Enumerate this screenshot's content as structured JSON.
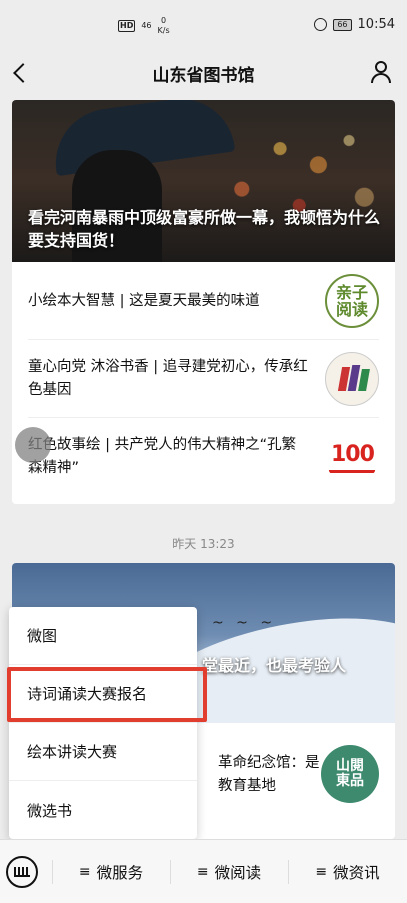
{
  "status": {
    "hd": "HD",
    "signal": "46",
    "speed_value": "0",
    "speed_unit": "K/s",
    "battery": "66",
    "time": "10:54"
  },
  "nav": {
    "title": "山东省图书馆"
  },
  "card1": {
    "headline": "看完河南暴雨中顶级富豪所做一幕，我顿悟为什么要支持国货！",
    "items": [
      {
        "text": "小绘本大智慧 | 这是夏天最美的味道",
        "thumb_text": "亲子阅读"
      },
      {
        "text": "童心向党 沐浴书香 | 追寻建党初心，传承红色基因",
        "thumb_text": ""
      },
      {
        "text": "红色故事绘 | 共产党人的伟大精神之“孔繁森精神”",
        "thumb_text": "100"
      }
    ]
  },
  "timestamp": "昨天 13:23",
  "card2": {
    "headline": "堂最近，也最考验人",
    "item_text": "革命纪念馆：是教育基地",
    "thumb_text": "山閱東品"
  },
  "menu": {
    "items": [
      "微图",
      "诗词诵读大赛报名",
      "绘本讲读大赛",
      "微选书"
    ],
    "highlighted_index": 1
  },
  "bottom": {
    "tabs": [
      "微服务",
      "微阅读",
      "微资讯"
    ],
    "menu_glyph": "≡"
  },
  "colors": {
    "highlight": "#e23e30",
    "background": "#ededed"
  }
}
